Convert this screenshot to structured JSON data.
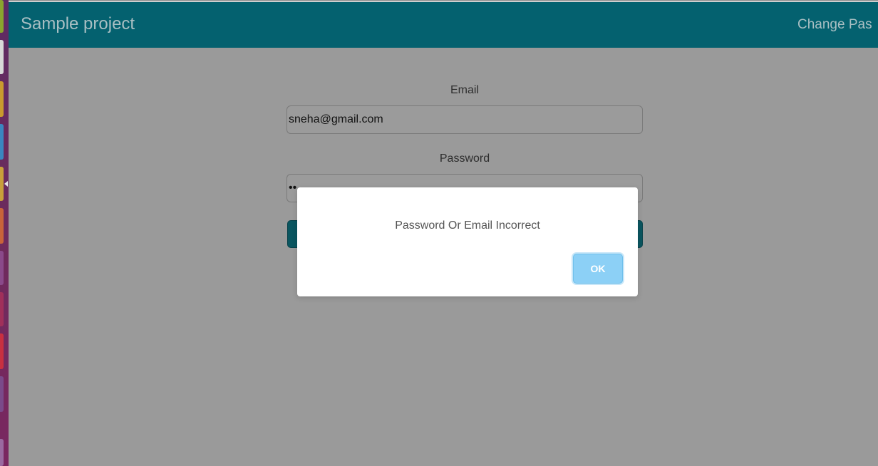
{
  "header": {
    "brand": "Sample project",
    "nav_change_password": "Change Pas"
  },
  "form": {
    "email_label": "Email",
    "email_value": "sneha@gmail.com",
    "password_label": "Password",
    "password_value": "••"
  },
  "alert": {
    "message": "Password Or Email Incorrect",
    "ok_label": "OK"
  },
  "colors": {
    "header": "#04616f",
    "overlay": "#9a9a9a",
    "ok_button": "#8cd0f6",
    "launcher": "#6d2b5c"
  }
}
